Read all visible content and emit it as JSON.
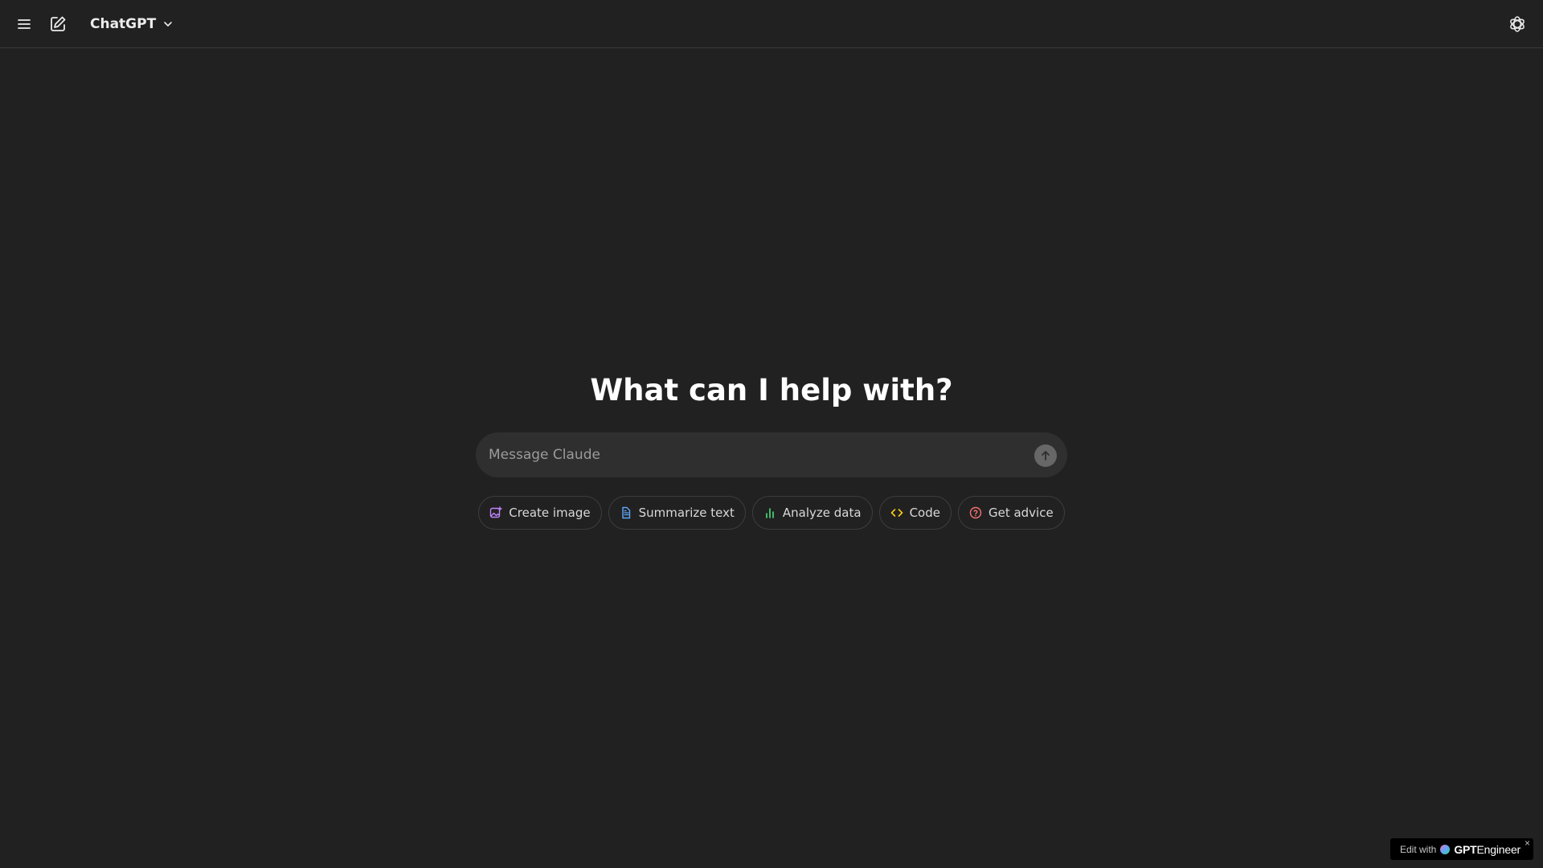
{
  "header": {
    "menu_icon": "menu-icon",
    "new_chat_icon": "new-chat-icon",
    "model_name": "ChatGPT",
    "model_chevron_icon": "chevron-down-icon",
    "logo_icon": "openai-logo-icon"
  },
  "main": {
    "headline": "What can I help with?",
    "composer": {
      "placeholder": "Message Claude",
      "value": "",
      "send_icon": "arrow-up-icon"
    },
    "suggestions": [
      {
        "label": "Create image",
        "icon": "image-sparkle-icon",
        "color": "#c084fc"
      },
      {
        "label": "Summarize text",
        "icon": "document-icon",
        "color": "#60a5fa"
      },
      {
        "label": "Analyze data",
        "icon": "bar-chart-icon",
        "color": "#4ade80"
      },
      {
        "label": "Code",
        "icon": "code-icon",
        "color": "#facc15"
      },
      {
        "label": "Get advice",
        "icon": "help-circle-icon",
        "color": "#f87171"
      }
    ]
  },
  "badge": {
    "prefix": "Edit with",
    "brand_bold": "GPT",
    "brand_rest": "Engineer",
    "close": "×"
  },
  "colors": {
    "background": "#212121",
    "composer_bg": "#2f2f2f",
    "text": "#ececec"
  }
}
